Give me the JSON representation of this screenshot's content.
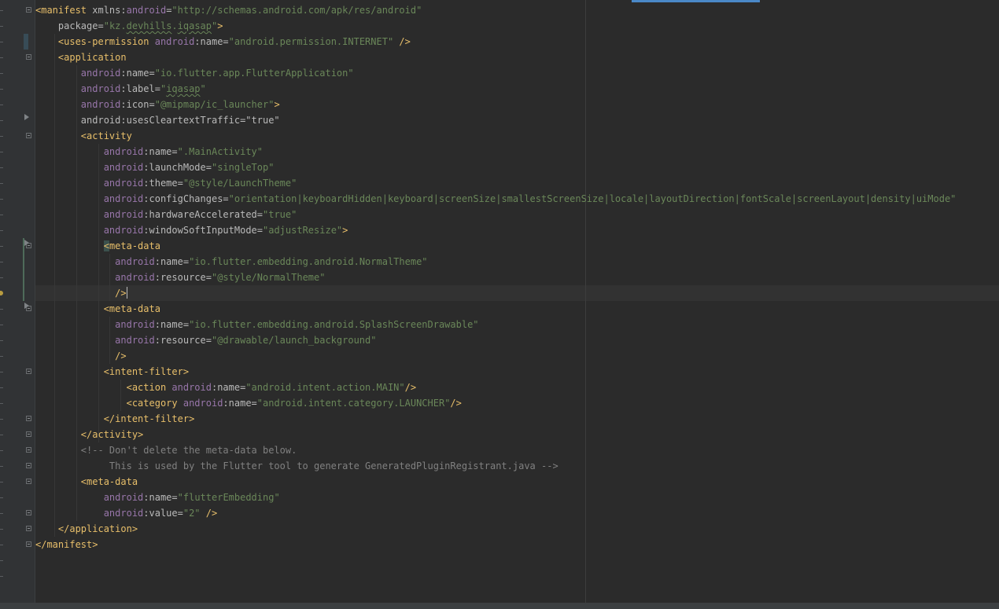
{
  "editor": {
    "colors": {
      "background": "#2b2b2b",
      "tag": "#e8bf6a",
      "namespace": "#9876aa",
      "attribute": "#bababa",
      "value": "#6a8759",
      "comment": "#808080"
    },
    "lines": [
      [
        {
          "t": "<manifest",
          "c": "tag"
        },
        {
          "t": " xmlns:",
          "c": "attr"
        },
        {
          "t": "android",
          "c": "ns"
        },
        {
          "t": "=",
          "c": "attr"
        },
        {
          "t": "\"http://schemas.android.com/apk/res/android\"",
          "c": "val"
        }
      ],
      [
        {
          "t": "    package",
          "c": "attr"
        },
        {
          "t": "=",
          "c": "attr"
        },
        {
          "t": "\"kz.",
          "c": "val"
        },
        {
          "t": "devhills",
          "c": "val squiggle"
        },
        {
          "t": ".",
          "c": "val"
        },
        {
          "t": "iqasap",
          "c": "val squiggle"
        },
        {
          "t": "\"",
          "c": "val"
        },
        {
          "t": ">",
          "c": "tag"
        }
      ],
      [
        {
          "t": "    <uses-permission",
          "c": "tag"
        },
        {
          "t": " android",
          "c": "ns"
        },
        {
          "t": ":name=",
          "c": "attr"
        },
        {
          "t": "\"android.permission.INTERNET\"",
          "c": "val"
        },
        {
          "t": " />",
          "c": "tag"
        }
      ],
      [
        {
          "t": "    <application",
          "c": "tag"
        }
      ],
      [
        {
          "t": "        android",
          "c": "ns"
        },
        {
          "t": ":name=",
          "c": "attr"
        },
        {
          "t": "\"io.flutter.app.FlutterApplication\"",
          "c": "val"
        }
      ],
      [
        {
          "t": "        android",
          "c": "ns"
        },
        {
          "t": ":label=",
          "c": "attr"
        },
        {
          "t": "\"",
          "c": "val"
        },
        {
          "t": "iqasap",
          "c": "val squiggle"
        },
        {
          "t": "\"",
          "c": "val"
        }
      ],
      [
        {
          "t": "        android",
          "c": "ns"
        },
        {
          "t": ":icon=",
          "c": "attr"
        },
        {
          "t": "\"@mipmap/ic_launcher\"",
          "c": "val"
        },
        {
          "t": ">",
          "c": "tag"
        }
      ],
      [
        {
          "t": "        android:usesCleartextTraffic=\"true\"",
          "c": "attr"
        }
      ],
      [
        {
          "t": "        <activity",
          "c": "tag"
        }
      ],
      [
        {
          "t": "            android",
          "c": "ns"
        },
        {
          "t": ":name=",
          "c": "attr"
        },
        {
          "t": "\".MainActivity\"",
          "c": "val"
        }
      ],
      [
        {
          "t": "            android",
          "c": "ns"
        },
        {
          "t": ":launchMode=",
          "c": "attr"
        },
        {
          "t": "\"singleTop\"",
          "c": "val"
        }
      ],
      [
        {
          "t": "            android",
          "c": "ns"
        },
        {
          "t": ":theme=",
          "c": "attr"
        },
        {
          "t": "\"@style/LaunchTheme\"",
          "c": "val"
        }
      ],
      [
        {
          "t": "            android",
          "c": "ns"
        },
        {
          "t": ":configChanges=",
          "c": "attr"
        },
        {
          "t": "\"orientation|keyboardHidden|keyboard|screenSize|smallestScreenSize|locale|layoutDirection|fontScale|screenLayout|density|uiMode\"",
          "c": "val"
        }
      ],
      [
        {
          "t": "            android",
          "c": "ns"
        },
        {
          "t": ":hardwareAccelerated=",
          "c": "attr"
        },
        {
          "t": "\"true\"",
          "c": "val"
        }
      ],
      [
        {
          "t": "            android",
          "c": "ns"
        },
        {
          "t": ":windowSoftInputMode=",
          "c": "attr"
        },
        {
          "t": "\"adjustResize\"",
          "c": "val"
        },
        {
          "t": ">",
          "c": "tag"
        }
      ],
      [
        {
          "t": "            ",
          "c": "attr"
        },
        {
          "t": "<",
          "c": "tag bracket-hl"
        },
        {
          "t": "meta-data",
          "c": "tag"
        }
      ],
      [
        {
          "t": "              android",
          "c": "ns"
        },
        {
          "t": ":name=",
          "c": "attr"
        },
        {
          "t": "\"io.flutter.embedding.android.NormalTheme\"",
          "c": "val"
        }
      ],
      [
        {
          "t": "              android",
          "c": "ns"
        },
        {
          "t": ":resource=",
          "c": "attr"
        },
        {
          "t": "\"@style/NormalTheme\"",
          "c": "val"
        }
      ],
      [
        {
          "t": "              />",
          "c": "tag"
        },
        {
          "t": "",
          "c": "caret"
        }
      ],
      [
        {
          "t": "            <meta-data",
          "c": "tag"
        }
      ],
      [
        {
          "t": "              android",
          "c": "ns"
        },
        {
          "t": ":name=",
          "c": "attr"
        },
        {
          "t": "\"io.flutter.embedding.android.SplashScreenDrawable\"",
          "c": "val"
        }
      ],
      [
        {
          "t": "              android",
          "c": "ns"
        },
        {
          "t": ":resource=",
          "c": "attr"
        },
        {
          "t": "\"@drawable/launch_background\"",
          "c": "val"
        }
      ],
      [
        {
          "t": "              />",
          "c": "tag"
        }
      ],
      [
        {
          "t": "            <intent-filter>",
          "c": "tag"
        }
      ],
      [
        {
          "t": "                <action",
          "c": "tag"
        },
        {
          "t": " android",
          "c": "ns"
        },
        {
          "t": ":name=",
          "c": "attr"
        },
        {
          "t": "\"android.intent.action.MAIN\"",
          "c": "val"
        },
        {
          "t": "/>",
          "c": "tag"
        }
      ],
      [
        {
          "t": "                <category",
          "c": "tag"
        },
        {
          "t": " android",
          "c": "ns"
        },
        {
          "t": ":name=",
          "c": "attr"
        },
        {
          "t": "\"android.intent.category.LAUNCHER\"",
          "c": "val"
        },
        {
          "t": "/>",
          "c": "tag"
        }
      ],
      [
        {
          "t": "            </intent-filter>",
          "c": "tag"
        }
      ],
      [
        {
          "t": "        </activity>",
          "c": "tag"
        }
      ],
      [
        {
          "t": "        <!-- Don't delete the meta-data below.",
          "c": "comment"
        }
      ],
      [
        {
          "t": "             This is used by the Flutter tool to generate GeneratedPluginRegistrant.java -->",
          "c": "comment"
        }
      ],
      [
        {
          "t": "        <meta-data",
          "c": "tag"
        }
      ],
      [
        {
          "t": "            android",
          "c": "ns"
        },
        {
          "t": ":name=",
          "c": "attr"
        },
        {
          "t": "\"flutterEmbedding\"",
          "c": "val"
        }
      ],
      [
        {
          "t": "            android",
          "c": "ns"
        },
        {
          "t": ":value=",
          "c": "attr"
        },
        {
          "t": "\"2\"",
          "c": "val"
        },
        {
          "t": " />",
          "c": "tag"
        }
      ],
      [
        {
          "t": "    </application>",
          "c": "tag"
        }
      ],
      [
        {
          "t": "</manifest>",
          "c": "tag"
        }
      ]
    ]
  }
}
